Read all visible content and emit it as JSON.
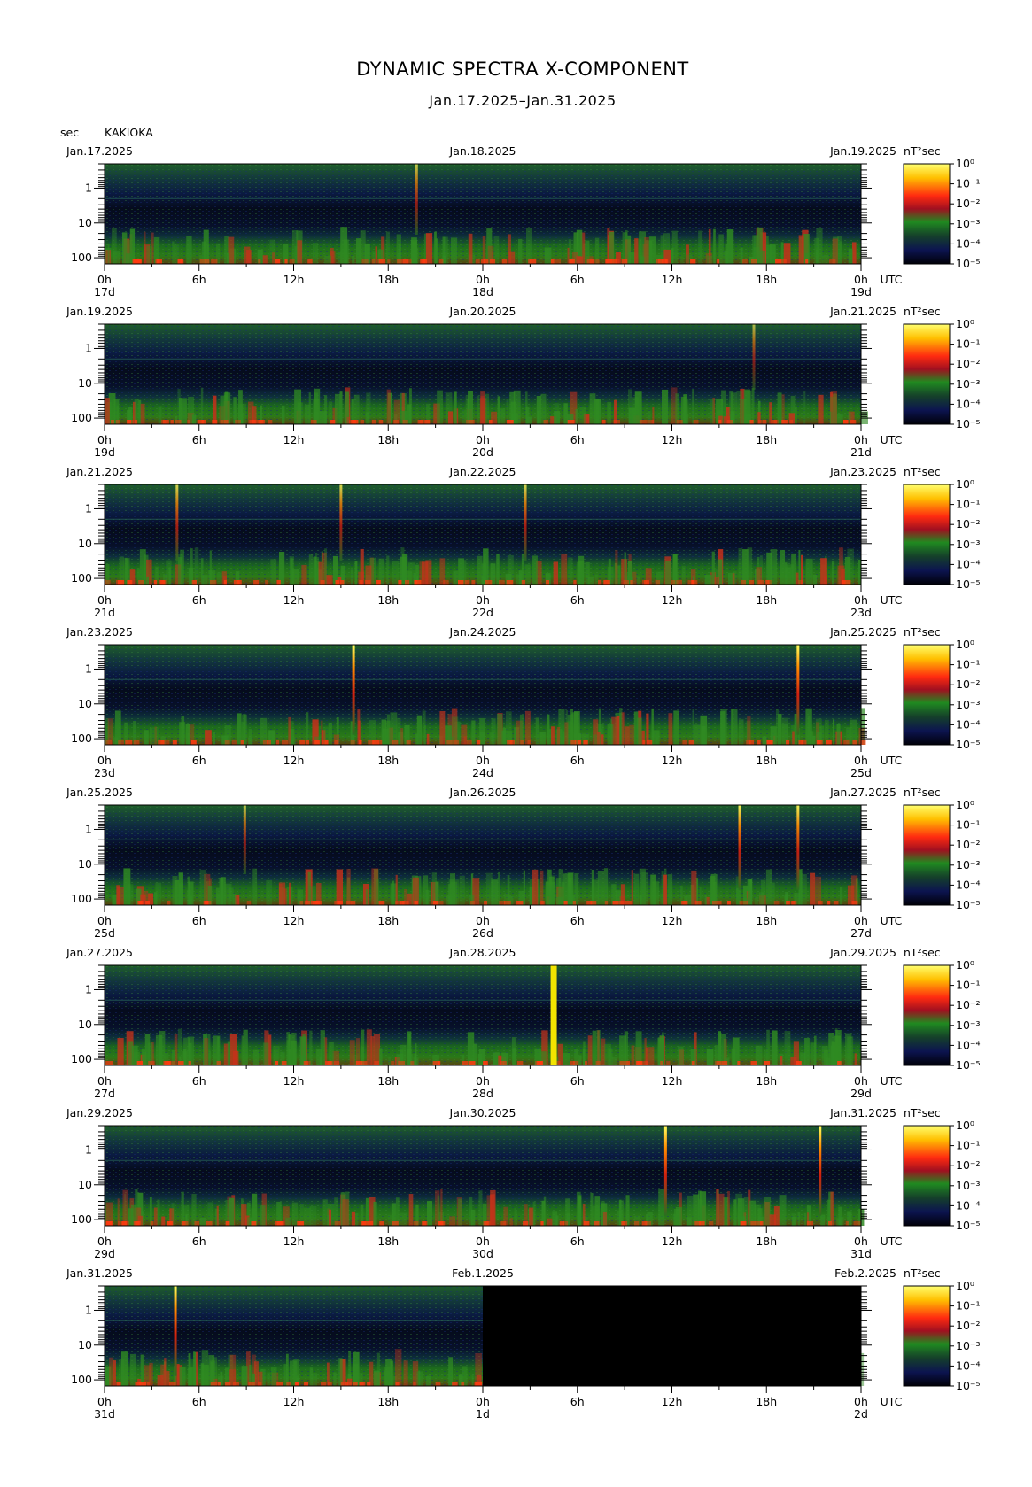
{
  "title": "DYNAMIC SPECTRA X-COMPONENT",
  "subtitle": "Jan.17.2025–Jan.31.2025",
  "station": "KAKIOKA",
  "y_unit": "sec",
  "colorbar_unit": "nT²sec",
  "utc_label": "UTC",
  "colors": {
    "background_dark": "#050a14",
    "spectra_green": "#1d6a1a",
    "spectra_red": "#e8281a",
    "spectra_yellow": "#ffe600",
    "nodata": "#000000"
  },
  "chart_data": {
    "type": "heatmap",
    "description_units": "period in sec (log scale, inverted), time in UTC hours, power in nT^2 sec",
    "yticks": [
      "1",
      "10",
      "100"
    ],
    "xticks_hours": [
      "0h",
      "6h",
      "12h",
      "18h",
      "0h",
      "6h",
      "12h",
      "18h",
      "0h"
    ],
    "colorbar_ticks": [
      "10⁰",
      "10⁻¹",
      "10⁻²",
      "10⁻³",
      "10⁻⁴",
      "10⁻⁵"
    ],
    "colorscale": [
      "#ffff60",
      "#ffc000",
      "#ff3010",
      "#b01020",
      "#208020",
      "#103820",
      "#0a1040",
      "#000008"
    ],
    "panels": [
      {
        "date_left": "Jan.17.2025",
        "date_mid": "Jan.18.2025",
        "date_right": "Jan.19.2025",
        "day_left": "17d",
        "day_mid": "18d",
        "day_right": "19d",
        "events": [
          {
            "hour": 19.8,
            "intensity": 0.45
          }
        ],
        "nodata_from_hour": null
      },
      {
        "date_left": "Jan.19.2025",
        "date_mid": "Jan.20.2025",
        "date_right": "Jan.21.2025",
        "day_left": "19d",
        "day_mid": "20d",
        "day_right": "21d",
        "events": [
          {
            "hour": 41.2,
            "intensity": 0.3
          }
        ],
        "nodata_from_hour": null
      },
      {
        "date_left": "Jan.21.2025",
        "date_mid": "Jan.22.2025",
        "date_right": "Jan.23.2025",
        "day_left": "21d",
        "day_mid": "22d",
        "day_right": "23d",
        "events": [
          {
            "hour": 4.6,
            "intensity": 0.6
          },
          {
            "hour": 15.0,
            "intensity": 0.6
          },
          {
            "hour": 26.7,
            "intensity": 0.6
          }
        ],
        "nodata_from_hour": null
      },
      {
        "date_left": "Jan.23.2025",
        "date_mid": "Jan.24.2025",
        "date_right": "Jan.25.2025",
        "day_left": "23d",
        "day_mid": "24d",
        "day_right": "25d",
        "events": [
          {
            "hour": 15.8,
            "intensity": 1.0
          },
          {
            "hour": 44.0,
            "intensity": 1.0
          }
        ],
        "nodata_from_hour": null
      },
      {
        "date_left": "Jan.25.2025",
        "date_mid": "Jan.26.2025",
        "date_right": "Jan.27.2025",
        "day_left": "25d",
        "day_mid": "26d",
        "day_right": "27d",
        "events": [
          {
            "hour": 8.9,
            "intensity": 0.4
          },
          {
            "hour": 40.3,
            "intensity": 0.85
          },
          {
            "hour": 44.0,
            "intensity": 0.85
          }
        ],
        "nodata_from_hour": null
      },
      {
        "date_left": "Jan.27.2025",
        "date_mid": "Jan.28.2025",
        "date_right": "Jan.29.2025",
        "day_left": "27d",
        "day_mid": "28d",
        "day_right": "29d",
        "events": [
          {
            "hour": 28.5,
            "intensity": 1.2
          }
        ],
        "nodata_from_hour": null
      },
      {
        "date_left": "Jan.29.2025",
        "date_mid": "Jan.30.2025",
        "date_right": "Jan.31.2025",
        "day_left": "29d",
        "day_mid": "30d",
        "day_right": "31d",
        "events": [
          {
            "hour": 35.6,
            "intensity": 1.0
          },
          {
            "hour": 45.4,
            "intensity": 1.0
          }
        ],
        "nodata_from_hour": null
      },
      {
        "date_left": "Jan.31.2025",
        "date_mid": "Feb.1.2025",
        "date_right": "Feb.2.2025",
        "day_left": "31d",
        "day_mid": "1d",
        "day_right": "2d",
        "events": [
          {
            "hour": 4.5,
            "intensity": 1.0
          }
        ],
        "nodata_from_hour": 24
      }
    ]
  }
}
